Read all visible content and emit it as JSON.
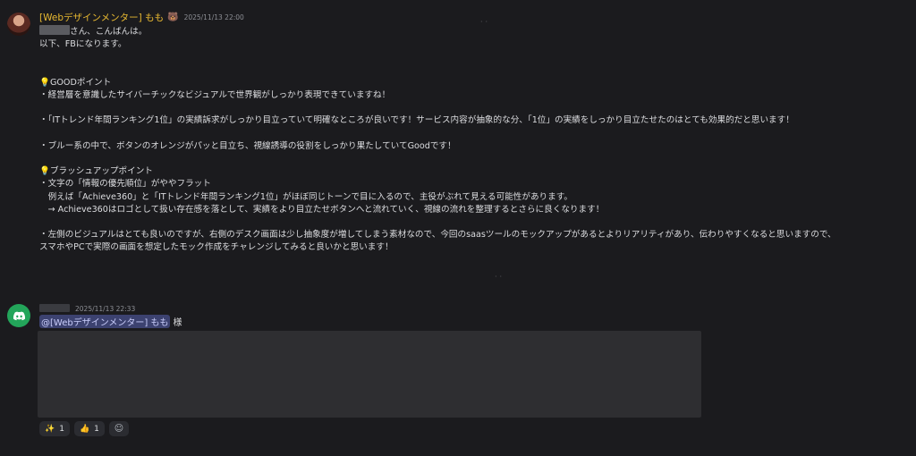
{
  "messages": [
    {
      "author": "[Webデザインメンター] もも",
      "author_icon": "bear-face",
      "timestamp": "2025/11/13 22:00",
      "greeting_suffix": "さん、こんばんは。",
      "body": "以下、FBになります。\n\n\n💡GOODポイント\n・経営層を意識したサイバーチックなビジュアルで世界観がしっかり表現できていますね！\n\n・「ITトレンド年間ランキング1位」の実績訴求がしっかり目立っていて明確なところが良いです！サービス内容が抽象的な分、「1位」の実績をしっかり目立たせたのはとても効果的だと思います！\n\n・ブルー系の中で、ボタンのオレンジがパッと目立ち、視線誘導の役割をしっかり果たしていてGoodです！\n\n💡ブラッシュアップポイント\n・文字の「情報の優先順位」がややフラット\n　例えば「Achieve360」と「ITトレンド年間ランキング1位」がほぼ同じトーンで目に入るので、主役がぶれて見える可能性があります。\n　→ Achieve360はロゴとして扱い存在感を落として、実績をより目立たせボタンへと流れていく、視線の流れを整理するとさらに良くなります！\n\n・左側のビジュアルはとても良いのですが、右側のデスク画面は少し抽象度が増してしまう素材なので、今回のsaasツールのモックアップがあるとよりリアリティがあり、伝わりやすくなると思いますので、\nスマホやPCで実際の画面を想定したモック作成をチャレンジしてみると良いかと思います！"
    },
    {
      "avatar_icon": "discord-icon",
      "timestamp": "2025/11/13 22:33",
      "mention": "@[Webデザインメンター] もも",
      "honorific": "様",
      "reactions": [
        {
          "emoji": "✨",
          "count": "1",
          "icon": "sparkles-icon"
        },
        {
          "emoji": "👍",
          "count": "1",
          "icon": "thumbs-up-icon"
        }
      ],
      "add_reaction_icon": "add-reaction-icon"
    }
  ],
  "colors": {
    "background": "#1b1b1e",
    "author": "#e8b931",
    "mention_bg": "#3c4270",
    "bot_avatar": "#23a55a"
  }
}
